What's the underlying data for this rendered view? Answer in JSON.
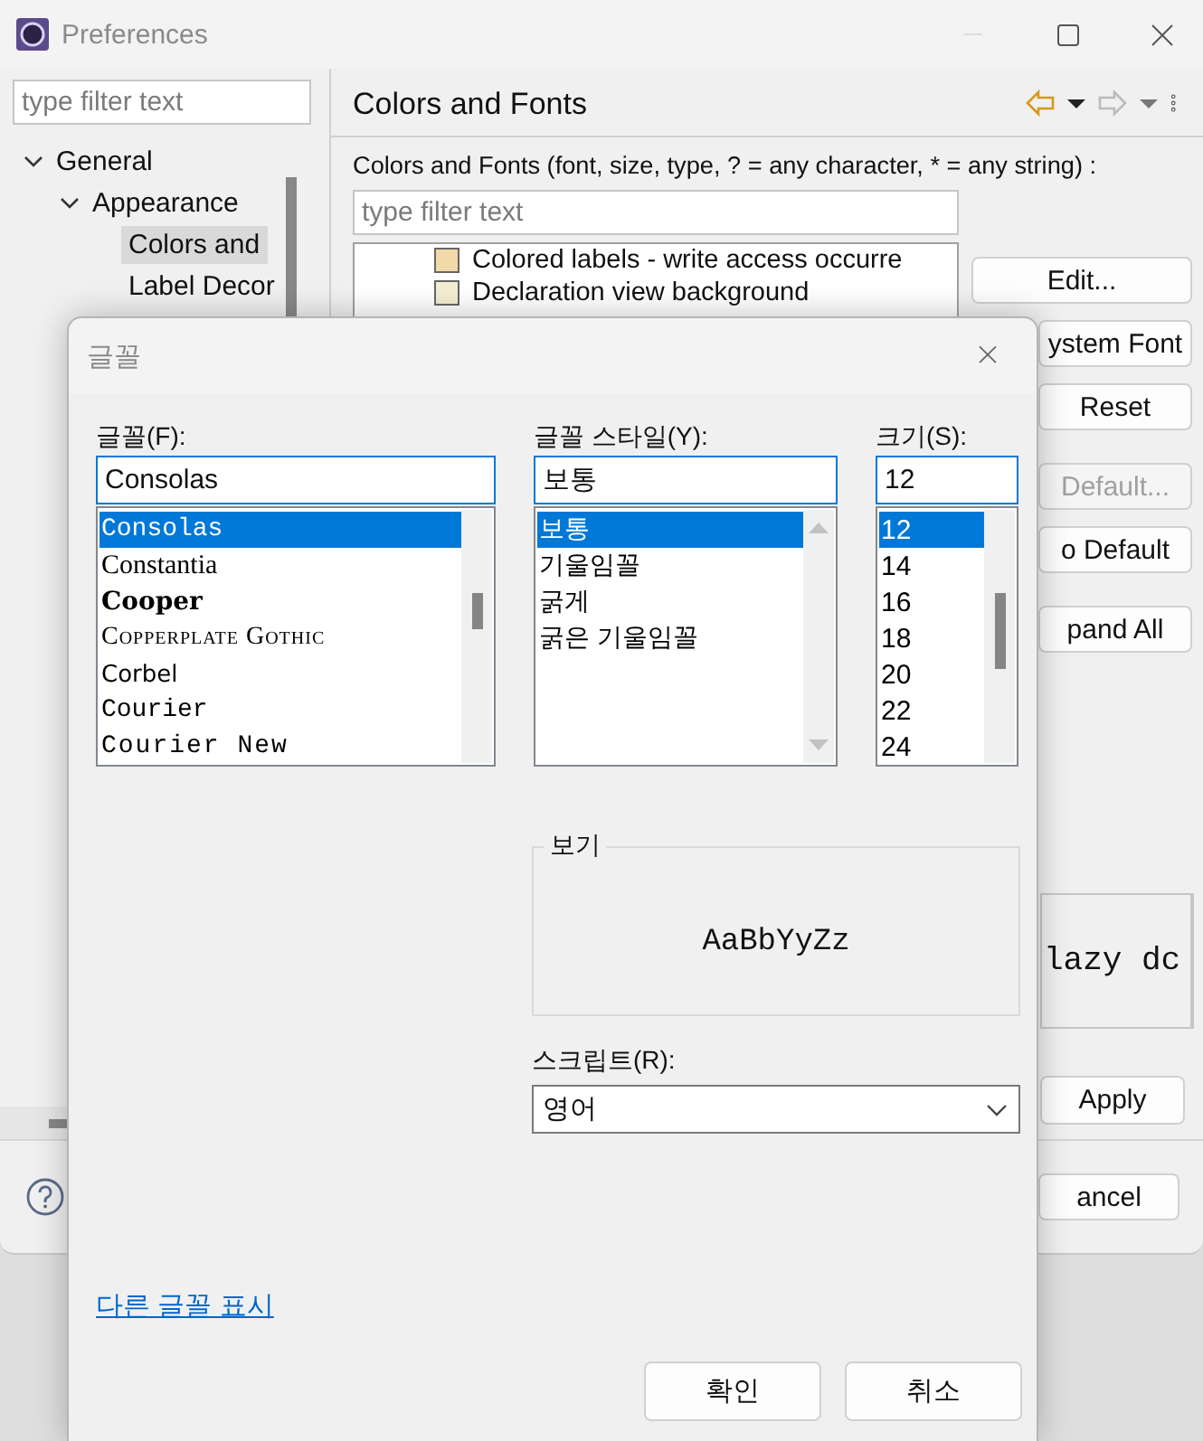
{
  "preferences": {
    "title": "Preferences",
    "filter": {
      "placeholder": "type filter text"
    },
    "tree": [
      {
        "label": "General",
        "expanded": true,
        "children": [
          {
            "label": "Appearance",
            "expanded": true,
            "children": [
              {
                "label": "Colors and",
                "selected": true
              },
              {
                "label": "Label Decor",
                "selected": false
              }
            ]
          }
        ]
      }
    ],
    "page_title": "Colors and Fonts",
    "description": "Colors and Fonts (font, size, type, ? = any character, * = any string) :",
    "page_filter": {
      "placeholder": "type filter text"
    },
    "entries": [
      {
        "label": "Colored labels - write access occurre",
        "color": "#f2d9a8"
      },
      {
        "label": "Declaration view background",
        "color": "#f4efd2"
      }
    ],
    "button_groups": [
      [
        {
          "label": "Edit...",
          "disabled": false
        },
        {
          "label": "ystem Font",
          "disabled": false
        },
        {
          "label": "Reset",
          "disabled": false
        }
      ],
      [
        {
          "label": "Default...",
          "disabled": true
        },
        {
          "label": "o Default",
          "disabled": false
        }
      ],
      [
        {
          "label": "pand All",
          "disabled": false
        }
      ]
    ],
    "preview_text": "lazy dc",
    "apply": "Apply",
    "cancel": "ancel"
  },
  "font_dialog": {
    "title": "글꼴",
    "font": {
      "label": "글꼴(F):",
      "value": "Consolas",
      "items": [
        {
          "label": "Consolas",
          "kind": "mono",
          "selected": true
        },
        {
          "label": "Constantia",
          "kind": "serif",
          "selected": false
        },
        {
          "label": "Cooper",
          "kind": "heavy",
          "selected": false
        },
        {
          "label": "Copperplate Gothic",
          "kind": "smallcaps",
          "selected": false
        },
        {
          "label": "Corbel",
          "kind": "sans",
          "selected": false
        },
        {
          "label": "Courier",
          "kind": "mono",
          "selected": false
        },
        {
          "label": "Courier New",
          "kind": "monowide",
          "selected": false
        }
      ]
    },
    "style": {
      "label": "글꼴 스타일(Y):",
      "value": "보통",
      "items": [
        {
          "label": "보통",
          "selected": true
        },
        {
          "label": "기울임꼴",
          "selected": false
        },
        {
          "label": "굵게",
          "selected": false
        },
        {
          "label": "굵은 기울임꼴",
          "selected": false
        }
      ]
    },
    "size": {
      "label": "크기(S):",
      "value": "12",
      "items": [
        {
          "label": "12",
          "selected": true
        },
        {
          "label": "14",
          "selected": false
        },
        {
          "label": "16",
          "selected": false
        },
        {
          "label": "18",
          "selected": false
        },
        {
          "label": "20",
          "selected": false
        },
        {
          "label": "22",
          "selected": false
        },
        {
          "label": "24",
          "selected": false
        }
      ]
    },
    "preview": {
      "label": "보기",
      "sample": "AaBbYyZz"
    },
    "script": {
      "label": "스크립트(R):",
      "value": "영어"
    },
    "more_fonts_link": "다른 글꼴 표시",
    "ok": "확인",
    "cancel": "취소"
  }
}
